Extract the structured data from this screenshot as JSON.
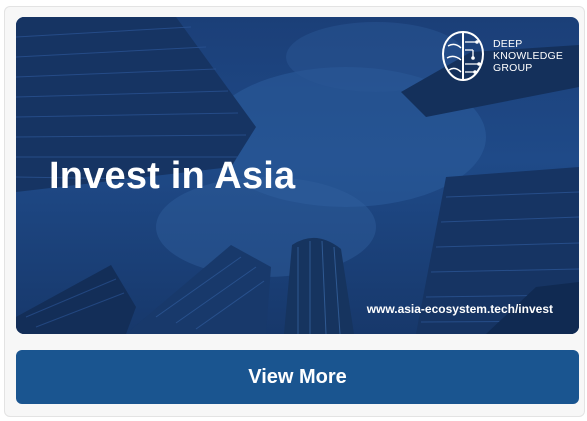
{
  "banner": {
    "headline": "Invest in Asia",
    "url": "www.asia-ecosystem.tech/invest",
    "logo": {
      "icon": "brain-circuit-icon",
      "line1": "DEEP",
      "line2": "KNOWLEDGE",
      "line3": "GROUP"
    },
    "overlay_color": "#1f4a88"
  },
  "cta": {
    "label": "View More",
    "color": "#1a5590"
  }
}
